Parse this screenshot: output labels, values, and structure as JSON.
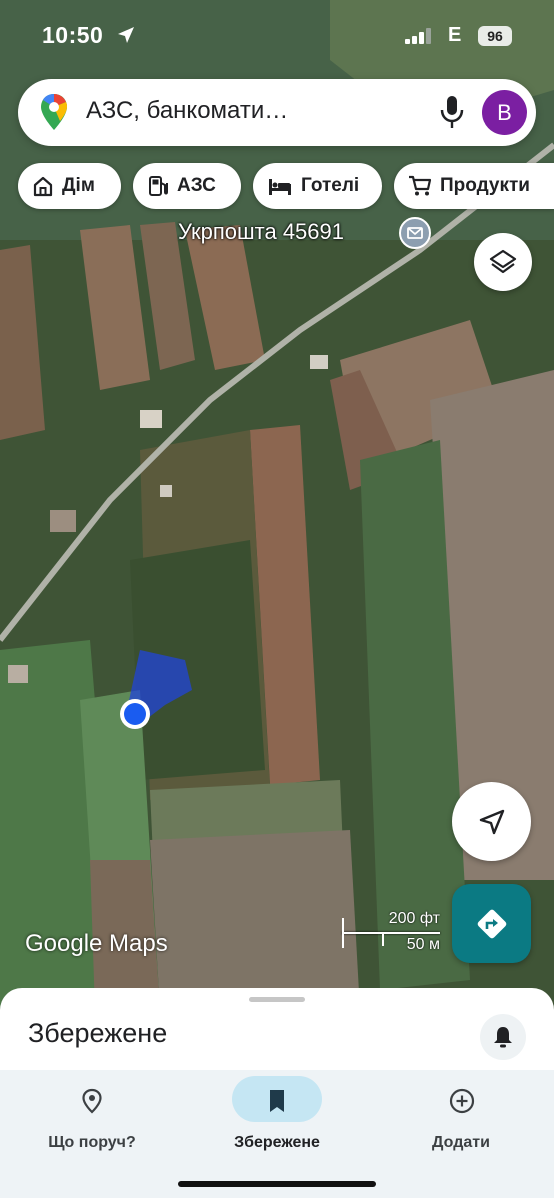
{
  "status_bar": {
    "time": "10:50",
    "network": "E",
    "battery": "96"
  },
  "search": {
    "text": "АЗС, банкомати…",
    "avatar_letter": "B"
  },
  "chips": [
    {
      "label": "Дім",
      "icon": "home-icon"
    },
    {
      "label": "АЗС",
      "icon": "gas-station-icon"
    },
    {
      "label": "Готелі",
      "icon": "bed-icon"
    },
    {
      "label": "Продукти",
      "icon": "cart-icon"
    }
  ],
  "map": {
    "poi_label": "Укрпошта 45691",
    "poi_icon": "mail-icon",
    "logo": "Google Maps",
    "scale_ft": "200 фт",
    "scale_m": "50 м"
  },
  "sheet": {
    "title": "Збережене"
  },
  "bottom_nav": {
    "items": [
      {
        "label": "Що поруч?",
        "icon": "location-pin-icon"
      },
      {
        "label": "Збережене",
        "icon": "bookmark-icon",
        "active": true
      },
      {
        "label": "Додати",
        "icon": "add-circle-icon"
      }
    ]
  },
  "colors": {
    "avatar": "#7b1fa2",
    "directions_button": "#0b7a83",
    "active_tab": "#c5e6f3",
    "location_dot": "#1a5cf0"
  }
}
